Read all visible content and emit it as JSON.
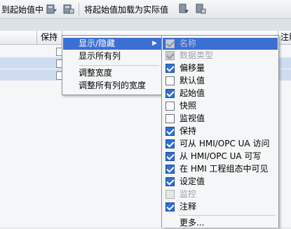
{
  "toolbar": {
    "left_label": "到起始值中",
    "right_label": "将起始值加载为实际值",
    "icons": [
      "snapshot-load-icon",
      "snapshot-copy-icon",
      "start-value-load-icon",
      "start-value-copy-icon"
    ]
  },
  "table": {
    "headers": [
      {
        "label": "保持"
      },
      {
        "label": "注释"
      }
    ],
    "rows": [
      {
        "selected": false
      },
      {
        "selected": true
      },
      {
        "selected": true
      }
    ]
  },
  "context_menu": {
    "items": [
      {
        "label": "显示/隐藏",
        "has_submenu": true,
        "highlighted": true
      },
      {
        "label": "显示所有列",
        "has_submenu": false,
        "highlighted": false
      },
      {
        "label": "调整宽度",
        "has_submenu": false,
        "highlighted": false
      },
      {
        "label": "调整所有列的宽度",
        "has_submenu": false,
        "highlighted": false
      }
    ]
  },
  "column_menu": {
    "items": [
      {
        "label": "名称",
        "checked": true,
        "disabled": true,
        "highlighted": true
      },
      {
        "label": "数据类型",
        "checked": true,
        "disabled": true,
        "highlighted": false
      },
      {
        "label": "偏移量",
        "checked": true,
        "disabled": false,
        "highlighted": false
      },
      {
        "label": "默认值",
        "checked": false,
        "disabled": false,
        "highlighted": false
      },
      {
        "label": "起始值",
        "checked": true,
        "disabled": false,
        "highlighted": false
      },
      {
        "label": "快照",
        "checked": false,
        "disabled": false,
        "highlighted": false
      },
      {
        "label": "监视值",
        "checked": false,
        "disabled": false,
        "highlighted": false
      },
      {
        "label": "保持",
        "checked": true,
        "disabled": false,
        "highlighted": false
      },
      {
        "label": "可从 HMI/OPC UA 访问",
        "checked": true,
        "disabled": false,
        "highlighted": false
      },
      {
        "label": "从 HMI/OPC UA 可写",
        "checked": true,
        "disabled": false,
        "highlighted": false
      },
      {
        "label": "在 HMI 工程组态中可见",
        "checked": true,
        "disabled": false,
        "highlighted": false
      },
      {
        "label": "设定值",
        "checked": true,
        "disabled": false,
        "highlighted": false
      },
      {
        "label": "监控",
        "checked": false,
        "disabled": true,
        "highlighted": false
      },
      {
        "label": "注释",
        "checked": true,
        "disabled": false,
        "highlighted": false
      }
    ],
    "more_label": "更多..."
  },
  "colors": {
    "highlight": "#3b6fd2",
    "checkbox_checked": "#2f6fd6",
    "menu_background": "#f5f6f7"
  }
}
